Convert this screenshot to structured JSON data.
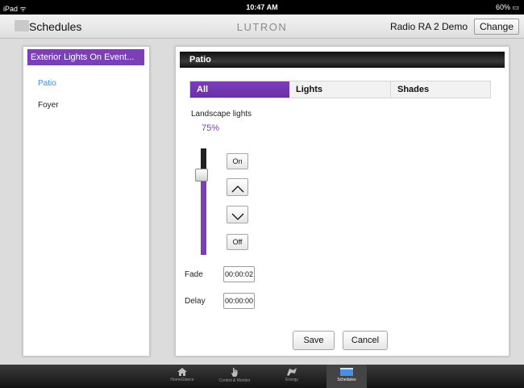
{
  "status_bar": {
    "device": "iPad ᯤ",
    "time": "10:47 AM",
    "battery": "60% ▭"
  },
  "header": {
    "title": "Schedules",
    "brand": "LUTRON",
    "system_name": "Radio RA 2 Demo",
    "change_label": "Change"
  },
  "event_list": {
    "selected_event": "Exterior Lights On Event...",
    "items": [
      {
        "label": "Patio",
        "color": "#3a8de0"
      },
      {
        "label": "Foyer",
        "color": "#222222"
      }
    ]
  },
  "room": {
    "title": "Patio"
  },
  "tabs": [
    {
      "label": "All",
      "active": true
    },
    {
      "label": "Lights",
      "active": false
    },
    {
      "label": "Shades",
      "active": false
    }
  ],
  "zone": {
    "name": "Landscape lights",
    "level_text": "75%",
    "level": 0.75
  },
  "controls": {
    "on_label": "On",
    "off_label": "Off"
  },
  "fade": {
    "label": "Fade",
    "value": "00:00:02"
  },
  "delay": {
    "label": "Delay",
    "value": "00:00:00"
  },
  "actions": {
    "save_label": "Save",
    "cancel_label": "Cancel"
  },
  "tabbar": [
    {
      "label": "HomeGlance",
      "icon": "home-icon",
      "active": false
    },
    {
      "label": "Control & Monitor",
      "icon": "hand-icon",
      "active": false
    },
    {
      "label": "Energy",
      "icon": "energy-icon",
      "active": false
    },
    {
      "label": "Schedules",
      "icon": "schedules-icon",
      "active": true
    }
  ],
  "colors": {
    "accent": "#7b3fb6",
    "link": "#3a8de0"
  }
}
